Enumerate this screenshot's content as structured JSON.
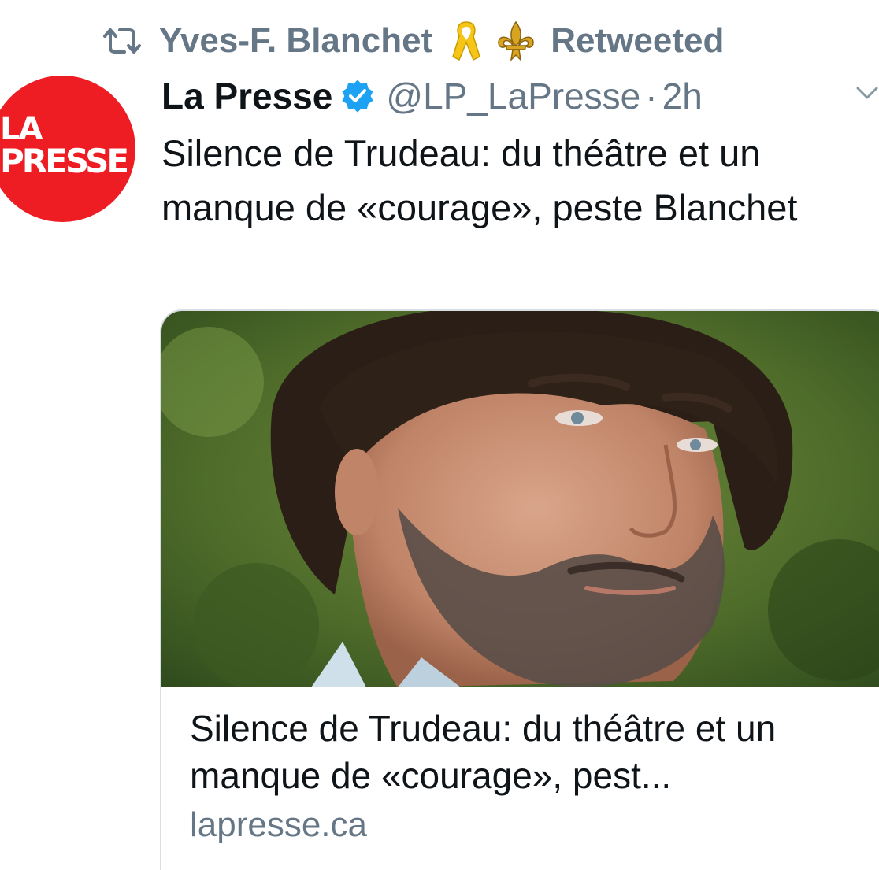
{
  "retweet": {
    "icon": "retweet-icon",
    "name": "Yves-F. Blanchet",
    "emojis": [
      "yellow-ribbon",
      "fleur-de-lis"
    ],
    "suffix": "Retweeted"
  },
  "tweet": {
    "author": {
      "name": "La Presse",
      "handle": "@LP_LaPresse",
      "verified": true,
      "avatar_text_line1": "LA",
      "avatar_text_line2": "PRESSE",
      "avatar_color": "#ee1d23"
    },
    "separator": "·",
    "time": "2h",
    "text": "Silence de Trudeau: du théâtre et un manque de «courage», peste Blanchet"
  },
  "card": {
    "title": "Silence de Trudeau: du théâtre et un manque de «courage», pest...",
    "domain": "lapresse.ca"
  },
  "colors": {
    "muted": "#657786",
    "text": "#0f1419",
    "verified": "#1da1f2",
    "brand": "#ee1d23"
  }
}
